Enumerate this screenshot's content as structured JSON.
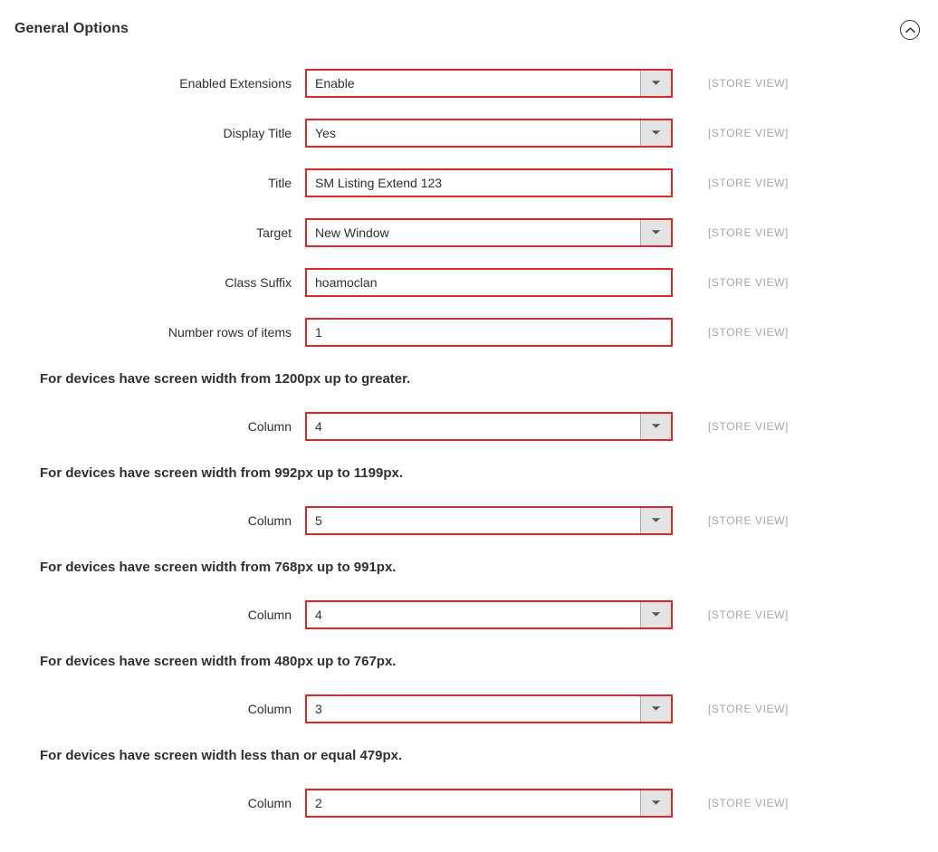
{
  "header": {
    "title": "General Options",
    "collapse_icon": "chevron-up-circle-icon"
  },
  "scope_label": "[STORE VIEW]",
  "dropdown_icon": "chevron-down-icon",
  "colors": {
    "field_border": "#e22626",
    "text": "#303030",
    "scope_text": "#a6a6a6",
    "dropdown_bg": "#e3e3e3"
  },
  "general_fields": [
    {
      "label": "Enabled Extensions",
      "value": "Enable",
      "type": "select",
      "scope": "[STORE VIEW]"
    },
    {
      "label": "Display Title",
      "value": "Yes",
      "type": "select",
      "scope": "[STORE VIEW]"
    },
    {
      "label": "Title",
      "value": "SM Listing Extend 123",
      "type": "text",
      "scope": "[STORE VIEW]"
    },
    {
      "label": "Target",
      "value": "New Window",
      "type": "select",
      "scope": "[STORE VIEW]"
    },
    {
      "label": "Class Suffix",
      "value": "hoamoclan",
      "type": "text",
      "scope": "[STORE VIEW]"
    },
    {
      "label": "Number rows of items",
      "value": "1",
      "type": "text",
      "scope": "[STORE VIEW]"
    }
  ],
  "responsive_groups": [
    {
      "heading": "For devices have screen width from 1200px up to greater.",
      "field": {
        "label": "Column",
        "value": "4",
        "type": "select",
        "scope": "[STORE VIEW]"
      }
    },
    {
      "heading": "For devices have screen width from 992px up to 1199px.",
      "field": {
        "label": "Column",
        "value": "5",
        "type": "select",
        "scope": "[STORE VIEW]"
      }
    },
    {
      "heading": "For devices have screen width from 768px up to 991px.",
      "field": {
        "label": "Column",
        "value": "4",
        "type": "select",
        "scope": "[STORE VIEW]"
      }
    },
    {
      "heading": "For devices have screen width from 480px up to 767px.",
      "field": {
        "label": "Column",
        "value": "3",
        "type": "select",
        "scope": "[STORE VIEW]"
      }
    },
    {
      "heading": "For devices have screen width less than or equal 479px.",
      "field": {
        "label": "Column",
        "value": "2",
        "type": "select",
        "scope": "[STORE VIEW]"
      }
    }
  ]
}
